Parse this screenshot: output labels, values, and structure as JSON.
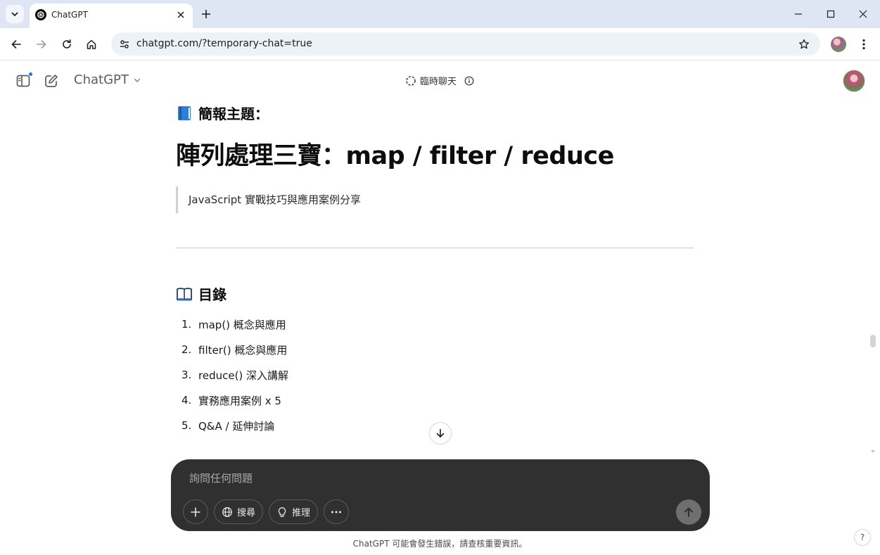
{
  "browser": {
    "tab_title": "ChatGPT",
    "url": "chatgpt.com/?temporary-chat=true"
  },
  "header": {
    "model_label": "ChatGPT",
    "temporary_chat_label": "臨時聊天"
  },
  "message": {
    "topic_heading": "簡報主題：",
    "title": "陣列處理三寶：map / filter / reduce",
    "subtitle_quote": "JavaScript 實戰技巧與應用案例分享",
    "toc_heading": "目錄",
    "toc_items": [
      {
        "num": "1.",
        "text": "map() 概念與應用"
      },
      {
        "num": "2.",
        "text": "filter() 概念與應用"
      },
      {
        "num": "3.",
        "text": "reduce() 深入講解"
      },
      {
        "num": "4.",
        "text": "實務應用案例 x 5"
      },
      {
        "num": "5.",
        "text": "Q&A / 延伸討論"
      }
    ]
  },
  "composer": {
    "placeholder": "詢問任何問題",
    "search_label": "搜尋",
    "reason_label": "推理"
  },
  "footer": {
    "disclaimer": "ChatGPT 可能會發生錯誤，請查核重要資訊。",
    "help_label": "?"
  }
}
